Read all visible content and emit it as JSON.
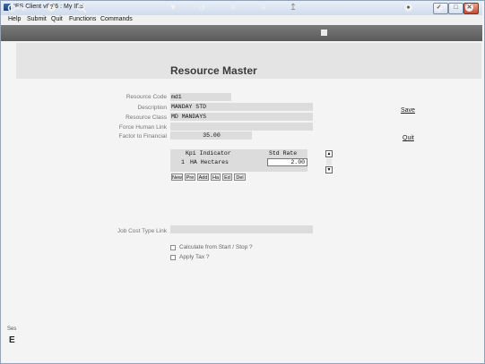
{
  "window": {
    "title": "IES Client v8.36 : My IES",
    "controls": {
      "minimize": "–",
      "maximize": "□",
      "close": "✕"
    }
  },
  "menu": [
    "Help",
    "Submit",
    "Quit",
    "Functions",
    "Commands"
  ],
  "toolbar": {
    "icons": [
      "key-icon",
      "help-icon",
      "search-icon",
      "heart-icon",
      "undo-icon",
      "rewind-icon",
      "forward-icon",
      "upload-icon",
      "stop-icon",
      "save-icon",
      "check-icon",
      "close-icon"
    ]
  },
  "page": {
    "title": "Resource Master"
  },
  "form": {
    "resource_code": {
      "label": "Resource Code",
      "value": "md1"
    },
    "description": {
      "label": "Description",
      "value": "MANDAY STD"
    },
    "resource_class": {
      "label": "Resource Class",
      "value": "MD MANDAYS"
    },
    "force_human_link": {
      "label": "Force Human Link",
      "value": ""
    },
    "factor_to_financial": {
      "label": "Factor to Financial",
      "value": "35.00"
    },
    "job_cost_type_link": {
      "label": "Job Cost Type Link",
      "value": ""
    }
  },
  "actions": {
    "save": "Save",
    "quit": "Quit"
  },
  "grid": {
    "headers": {
      "kpi": "Kpi Indicator",
      "rate": "Std Rate"
    },
    "rows": [
      {
        "num": "1",
        "kpi": "HA Hectares",
        "rate": "2.00"
      }
    ],
    "buttons": [
      "New",
      "Pre",
      "Add",
      "Ha",
      "Ed",
      "Del"
    ],
    "scroll": {
      "up": "▲",
      "down": "▼"
    }
  },
  "options": {
    "calc_start_stop": {
      "label": "Calculate from Start / Stop ?",
      "checked": false
    },
    "apply_tax": {
      "label": "Apply Tax ?",
      "checked": false
    }
  },
  "side": {
    "label": "Ses",
    "glyph": "E"
  }
}
